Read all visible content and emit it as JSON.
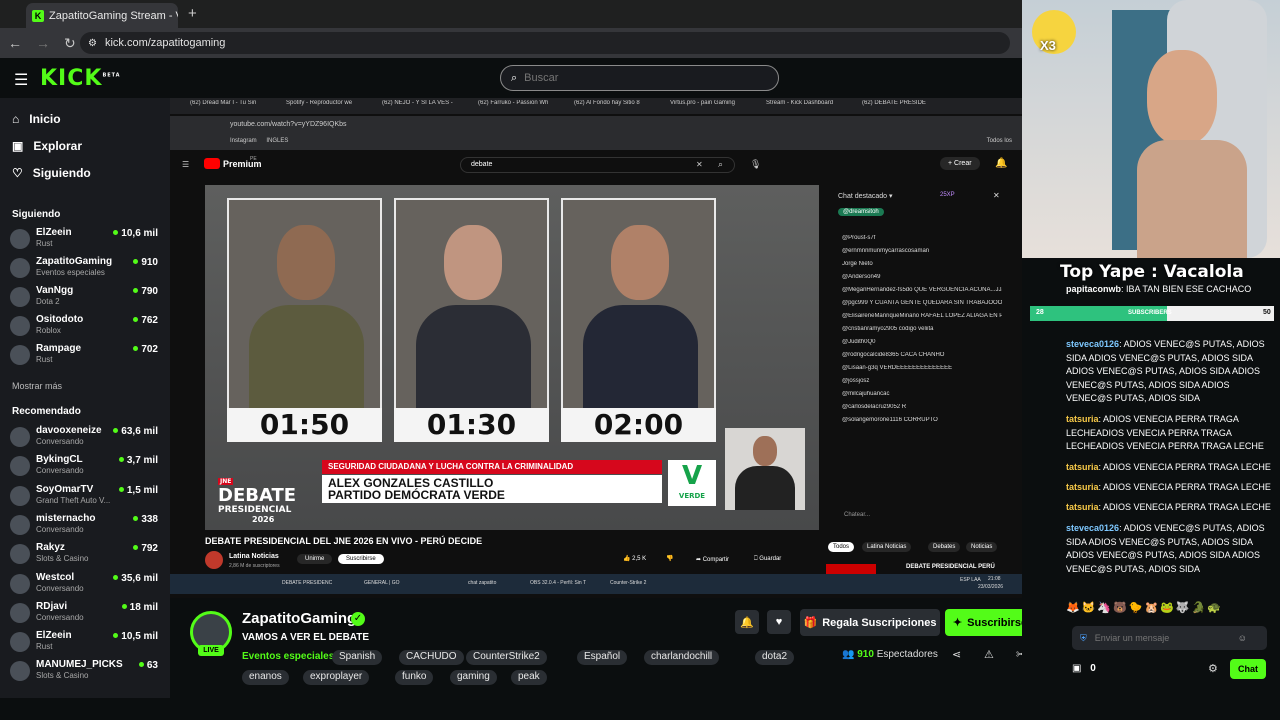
{
  "browser": {
    "tab_title": "ZapatitoGaming Stream - V",
    "url": "kick.com/zapatitogaming"
  },
  "header": {
    "logo": "KICK",
    "logo_sup": "BETA",
    "search_placeholder": "Buscar"
  },
  "sidebar": {
    "nav": [
      {
        "label": "Inicio",
        "icon": "home-icon"
      },
      {
        "label": "Explorar",
        "icon": "explore-icon"
      },
      {
        "label": "Siguiendo",
        "icon": "heart-icon"
      }
    ],
    "following_heading": "Siguiendo",
    "following": [
      {
        "name": "ElZeein",
        "category": "Rust",
        "viewers": "10,6 mil"
      },
      {
        "name": "ZapatitoGaming",
        "category": "Eventos especiales",
        "viewers": "910"
      },
      {
        "name": "VanNgg",
        "category": "Dota 2",
        "viewers": "790"
      },
      {
        "name": "Ositodoto",
        "category": "Roblox",
        "viewers": "762"
      },
      {
        "name": "Rampage",
        "category": "Rust",
        "viewers": "702"
      }
    ],
    "show_more": "Mostrar más",
    "recommended_heading": "Recomendado",
    "recommended": [
      {
        "name": "davooxeneize",
        "category": "Conversando",
        "viewers": "63,6 mil"
      },
      {
        "name": "BykingCL",
        "category": "Conversando",
        "viewers": "3,7 mil"
      },
      {
        "name": "SoyOmarTV",
        "category": "Grand Theft Auto V...",
        "viewers": "1,5 mil"
      },
      {
        "name": "misternacho",
        "category": "Conversando",
        "viewers": "338"
      },
      {
        "name": "Rakyz",
        "category": "Slots & Casino",
        "viewers": "792"
      },
      {
        "name": "Westcol",
        "category": "Conversando",
        "viewers": "35,6 mil"
      },
      {
        "name": "RDjavi",
        "category": "Conversando",
        "viewers": "18 mil"
      },
      {
        "name": "ElZeein",
        "category": "Rust",
        "viewers": "10,5 mil"
      },
      {
        "name": "MANUMEJ_PICKS",
        "category": "Slots & Casino",
        "viewers": "63"
      }
    ]
  },
  "stream_screen": {
    "tabs": [
      "(62) Dread Mar I - Tu Sin",
      "Spotify - Reproductor we",
      "(62) ÑEJO - Y SI LA VES -",
      "(62) Farruko - Passion Wh",
      "(62) Al Fondo hay Sitio 8",
      "Virtus.pro - pain Gaming",
      "Stream - Kick Dashboard",
      "(62) DEBATE PRESIDE"
    ],
    "url": "youtube.com/watch?v=yYDZ96IQKbs",
    "bookmark": "Instagram",
    "bookmark2": "INGLES",
    "bookmarks_all": "Todos los",
    "yt_brand": "Premium",
    "yt_brand_sup": "PE",
    "yt_search": "debate",
    "yt_create": "Crear",
    "timers": [
      "01:50",
      "01:30",
      "02:00"
    ],
    "topic": "SEGURIDAD CIUDADANA Y LUCHA CONTRA LA CRIMINALIDAD",
    "candidate_line1": "ALEX GONZALES CASTILLO",
    "candidate_line2": "PARTIDO DEMÓCRATA VERDE",
    "debate_logo_sup": "JNE",
    "debate_logo_main": "DEBATE",
    "debate_logo_sub": "PRESIDENCIAL",
    "debate_logo_year": "2026",
    "party_letter": "V",
    "party_name": "VERDE",
    "video_title": "DEBATE PRESIDENCIAL DEL JNE 2026 EN VIVO - PERÚ DECIDE",
    "channel": "Latina Noticias",
    "channel_subs": "2,86 M de suscriptores",
    "join": "Unirme",
    "subscribe": "Suscribirse",
    "likes": "2,5 K",
    "share": "Compartir",
    "save": "Guardar",
    "chat_header": "Chat destacado",
    "chat_xp": "25XP",
    "chat_pinned": "@dreamsitoh",
    "chat_lines": [
      "@Proust-s7f",
      "@ernmnnmunmycarrascosaman",
      "Jorge Nieto",
      "@Anderson49",
      "@MeganHernandez-fs5do QUE VERGUENCIA ACUÑA...JJJJ",
      "@pgc999 Y CUANTA GENTE QUEDARA SIN TRABAJOOOOO AY PORKY NO JODASSS",
      "@ElisaireneManriqueMiñano RAFAEL LOPEZ ALIAGA EN PRIMERA VUELTA",
      "@cristianramyo2905 codigo veliita",
      "@Judith0Q0",
      "@rodrigocalcide8365 CACA CHANHO",
      "@Lisaan-g3q VERDEEEEEEEEEEEEEE",
      "@jossjosz",
      "@milcajuhuancac",
      "@carlosdelacruz9052 R",
      "@solangemorone1116 CORRUPTO"
    ],
    "chat_input": "Chatear...",
    "chips": [
      "Todos",
      "Latina Noticias",
      "Debates",
      "Noticias"
    ],
    "next_video": "DEBATE PRESIDENCIAL PERÚ",
    "taskbar": [
      "DEBATE PRESIDENC",
      "GENERAL | GO",
      "chat zapatito",
      "OBS 32.0.4 - Perfil: Sin T",
      "Counter-Strike 2"
    ],
    "tray_lang": "ESP LAA",
    "tray_time": "21:08",
    "tray_date": "23/03/2026"
  },
  "webcam": {
    "badge": "X3"
  },
  "stream_info": {
    "channel_name": "ZapatitoGaming",
    "live_badge": "LIVE",
    "title": "VAMOS A VER EL DEBATE",
    "category": "Eventos especiales",
    "tags": [
      "Spanish",
      "CACHUDO",
      "CounterStrike2",
      "Español",
      "charlandochill",
      "dota2",
      "enanos",
      "exproplayer",
      "funko",
      "gaming",
      "peak"
    ],
    "gift_label": "Regala Suscripciones",
    "subscribe_label": "Suscribirse",
    "viewers_count": "910",
    "viewers_label": "Espectadores"
  },
  "chat": {
    "overlay_title": "Top Yape : Vacalola",
    "sub_goal_left": "28",
    "sub_goal_label": "SUBSCRIBERS",
    "sub_goal_right": "50",
    "sub_goal_fraction": 0.56,
    "messages": [
      {
        "user": "papitaconwb",
        "text": "IBA TAN BIEN ESE CACHACO",
        "color": "#ffffff"
      },
      {
        "user": "steveca0126",
        "text": "ADIOS VENEC@S PUTAS, ADIOS SIDA ADIOS VENEC@S PUTAS, ADIOS SIDA ADIOS VENEC@S PUTAS, ADIOS SIDA ADIOS VENEC@S PUTAS, ADIOS SIDA ADIOS VENEC@S PUTAS, ADIOS SIDA",
        "color": "#7ec8ff"
      },
      {
        "user": "tatsuria",
        "text": "ADIOS VENECIA PERRA TRAGA LECHEADIOS VENECIA PERRA TRAGA LECHEADIOS VENECIA PERRA TRAGA LECHE",
        "color": "#f7c948"
      },
      {
        "user": "tatsuria",
        "text": "ADIOS VENECIA PERRA TRAGA LECHE",
        "color": "#f7c948"
      },
      {
        "user": "tatsuria",
        "text": "ADIOS VENECIA PERRA TRAGA LECHE",
        "color": "#f7c948"
      },
      {
        "user": "tatsuria",
        "text": "ADIOS VENECIA PERRA TRAGA LECHE",
        "color": "#f7c948"
      },
      {
        "user": "steveca0126",
        "text": "ADIOS VENEC@S PUTAS, ADIOS SIDA ADIOS VENEC@S PUTAS, ADIOS SIDA ADIOS VENEC@S PUTAS, ADIOS SIDA ADIOS VENEC@S PUTAS, ADIOS SIDA",
        "color": "#7ec8ff"
      }
    ],
    "input_placeholder": "Enviar un mensaje",
    "points": "0",
    "chat_button": "Chat"
  },
  "colors": {
    "accent": "#53fc18",
    "sidebar_bg": "#191b1f",
    "page_bg": "#0b0e0f"
  }
}
